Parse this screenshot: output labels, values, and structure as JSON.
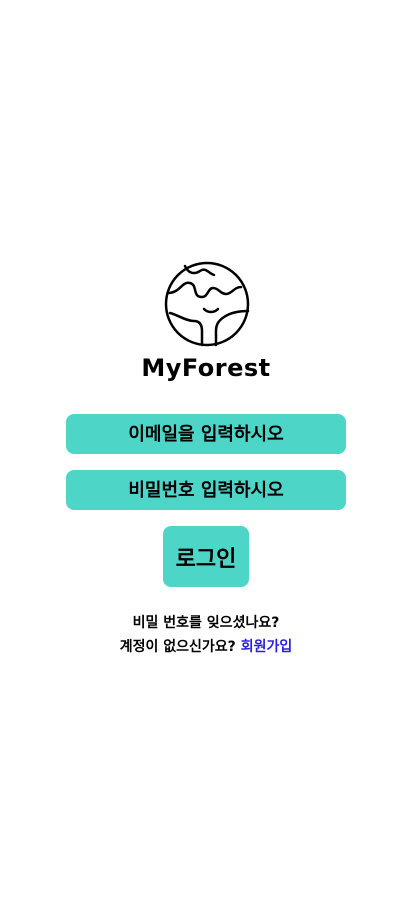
{
  "app": {
    "name": "MyForest",
    "logo_icon": "globe-icon"
  },
  "login_form": {
    "email_placeholder": "이메일을 입력하시오",
    "password_placeholder": "비밀번호 입력하시오",
    "login_label": "로그인"
  },
  "links": {
    "forgot_password": "비밀 번호를 잊으셨나요?",
    "no_account": "계정이 없으신가요?",
    "signup": "회원가입"
  },
  "colors": {
    "accent": "#4dd6c8",
    "link": "#2a1fe0"
  }
}
